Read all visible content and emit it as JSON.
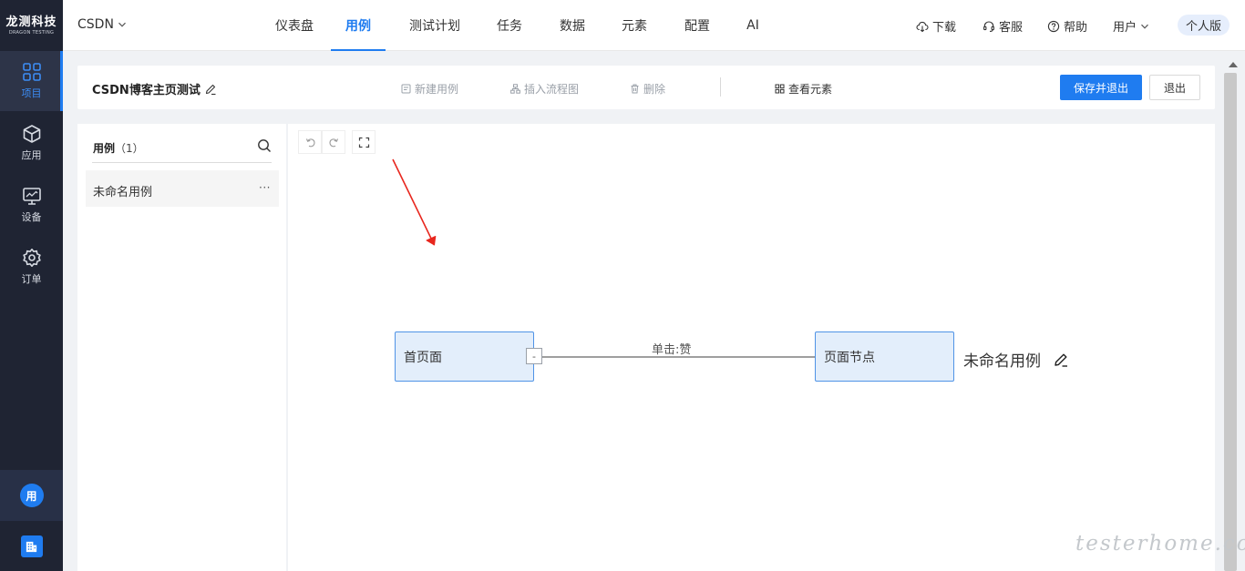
{
  "brand": {
    "name": "龙测科技",
    "tagline": "DRAGON TESTING"
  },
  "leftnav": {
    "items": [
      {
        "label": "项目",
        "icon": "grid-icon",
        "active": true
      },
      {
        "label": "应用",
        "icon": "cube-icon",
        "active": false
      },
      {
        "label": "设备",
        "icon": "monitor-icon",
        "active": false
      },
      {
        "label": "订单",
        "icon": "gear-icon",
        "active": false
      }
    ],
    "user_avatar": "用",
    "org_icon": "building-icon"
  },
  "topbar": {
    "project": "CSDN",
    "tabs": [
      {
        "label": "仪表盘",
        "active": false
      },
      {
        "label": "用例",
        "active": true
      },
      {
        "label": "测试计划",
        "active": false
      },
      {
        "label": "任务",
        "active": false
      },
      {
        "label": "数据",
        "active": false
      },
      {
        "label": "元素",
        "active": false
      },
      {
        "label": "配置",
        "active": false
      },
      {
        "label": "AI",
        "active": false
      }
    ],
    "download": "下载",
    "support": "客服",
    "help": "帮助",
    "user_menu": "用户",
    "edition": "个人版"
  },
  "toolbar": {
    "case_title": "CSDN博客主页测试",
    "new_case": "新建用例",
    "insert_flow": "插入流程图",
    "delete": "删除",
    "view_elements": "查看元素",
    "save_exit": "保存并退出",
    "exit": "退出"
  },
  "case_panel": {
    "title": "用例",
    "count": "（1）",
    "items": [
      {
        "label": "未命名用例",
        "more": "···"
      }
    ]
  },
  "canvas": {
    "nodes": [
      {
        "label": "首页面"
      },
      {
        "label": "页面节点"
      }
    ],
    "collapse_symbol": "-",
    "edge_label": "单击:赞",
    "flow_name": "未命名用例"
  },
  "watermark": "testerhome.com",
  "colors": {
    "primary": "#1f7cf0",
    "nav_bg": "#1f2433",
    "node_fill": "#e3eefb",
    "node_border": "#4f93e6",
    "annotation_arrow": "#e8271e"
  }
}
